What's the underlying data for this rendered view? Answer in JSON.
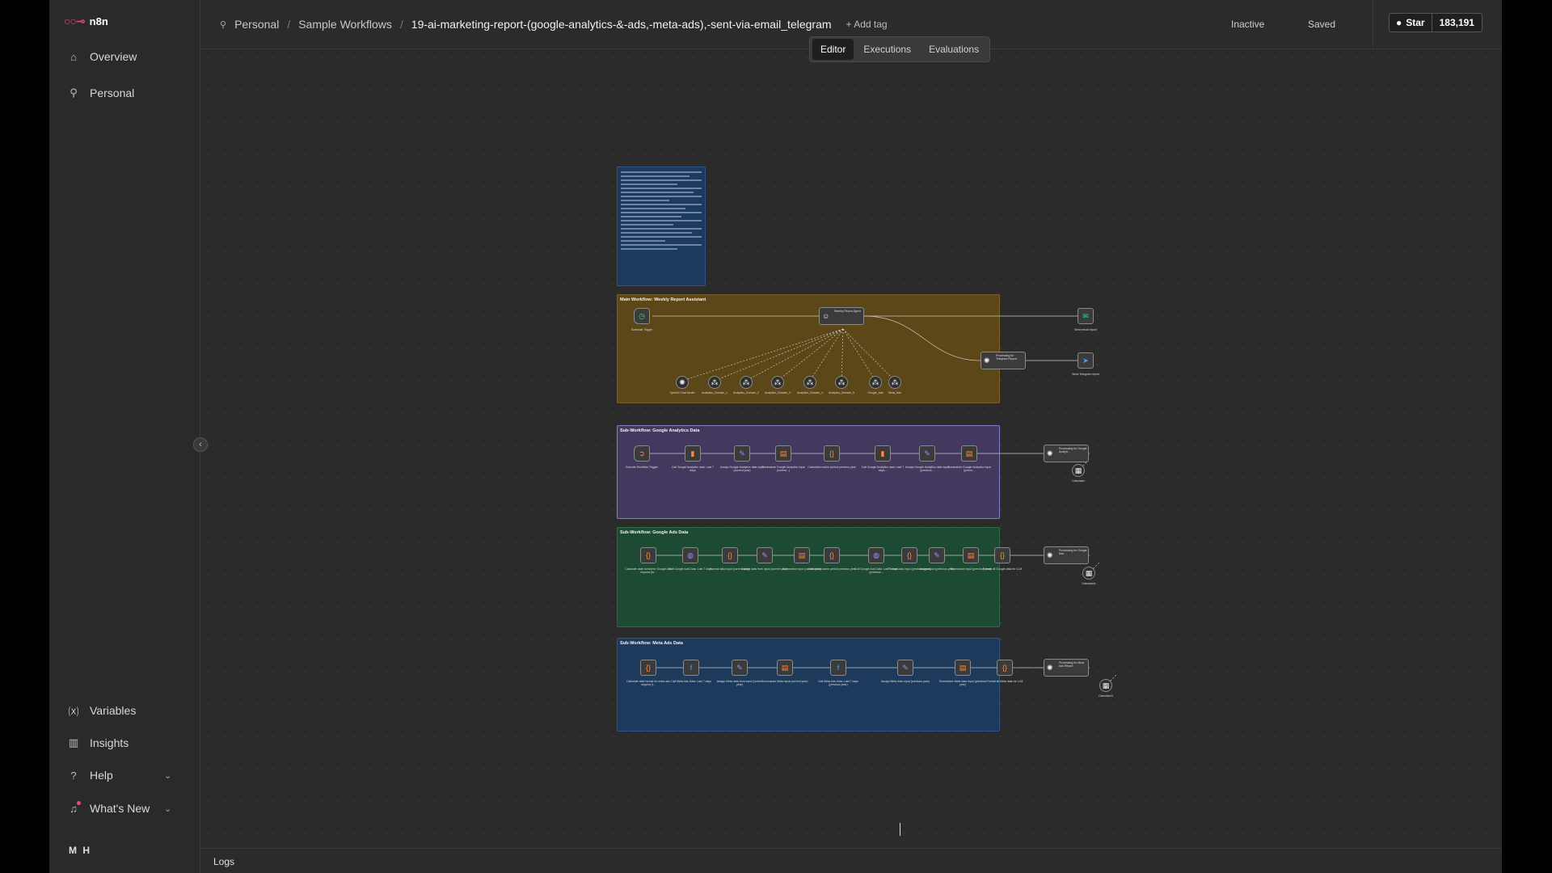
{
  "app": {
    "logo_text": "n8n",
    "user_initials": "M H"
  },
  "sidebar": {
    "items": [
      {
        "label": "Overview",
        "icon": "home-icon"
      },
      {
        "label": "Personal",
        "icon": "user-icon"
      }
    ],
    "bottom_items": [
      {
        "label": "Variables",
        "icon": "variables-icon"
      },
      {
        "label": "Insights",
        "icon": "chart-icon"
      },
      {
        "label": "Help",
        "icon": "help-icon"
      },
      {
        "label": "What's New",
        "icon": "bell-icon"
      }
    ]
  },
  "header": {
    "breadcrumb": [
      "Personal",
      "Sample Workflows"
    ],
    "workflow_name": "19-ai-marketing-report-(google-analytics-&-ads,-meta-ads),-sent-via-email_telegram",
    "add_tag": "+ Add tag",
    "status_active": "Inactive",
    "status_saved": "Saved",
    "github_star": "Star",
    "github_count": "183,191"
  },
  "tabs": [
    {
      "label": "Editor",
      "active": true
    },
    {
      "label": "Executions",
      "active": false
    },
    {
      "label": "Evaluations",
      "active": false
    }
  ],
  "canvas": {
    "notes": [
      {
        "title": "Main Workflow: Weekly Report Assistant",
        "color": "#5b4717"
      },
      {
        "title": "Sub-Workflow: Google Analytics Data",
        "color": "#43395f"
      },
      {
        "title": "Sub-Workflow: Google Ads Data",
        "color": "#1d4a32"
      },
      {
        "title": "Sub-Workflow: Meta Ads Data",
        "color": "#1d3a5c"
      }
    ],
    "main_nodes": [
      {
        "label": "Schedule Trigger"
      },
      {
        "label": "Weekly Report Agent"
      },
      {
        "label": "Send email report"
      },
      {
        "label": "Processing for Telegram Report"
      },
      {
        "label": "Send Telegram report"
      },
      {
        "label": "OpenAI Chat Model"
      },
      {
        "label": "Analytics_Domain_1"
      },
      {
        "label": "Analytics_Domain_2"
      },
      {
        "label": "Analytics_Domain_3"
      },
      {
        "label": "Analytics_Domain_4"
      },
      {
        "label": "Analytics_Domain_5"
      },
      {
        "label": "Google_Ads"
      },
      {
        "label": "Meta_Ads"
      }
    ],
    "ga_nodes": [
      {
        "label": "Execute Workflow Trigger"
      },
      {
        "label": "Call Google Analytics data: Last 7 days"
      },
      {
        "label": "Assign Google Analytics data input (current year)"
      },
      {
        "label": "Summarize Google Analytics input (current...)"
      },
      {
        "label": "Calculation same period previous year"
      },
      {
        "label": "Call Google Analytics data: Last 7 days..."
      },
      {
        "label": "Assign Google Analytics data input (previous..."
      },
      {
        "label": "Summarize Google Analytics input (previo..."
      },
      {
        "label": "Processing for Google Analyti..."
      },
      {
        "label": "Calculator"
      }
    ],
    "gads_nodes": [
      {
        "label": "Calculate date format for Google Ads request (la..."
      },
      {
        "label": "Call Google Ads Data: Last 7 days"
      },
      {
        "label": "Format data input (current year)"
      },
      {
        "label": "Assign data from input (current year)"
      },
      {
        "label": "Summarize input (current year)"
      },
      {
        "label": "Calculation same period previous year"
      },
      {
        "label": "Call Google Ads Data: Last 7 days (previous..."
      },
      {
        "label": "Format data input (previous year)"
      },
      {
        "label": "Assign input (previous year)"
      },
      {
        "label": "Summarize input (previous year)"
      },
      {
        "label": "Format all Google data for LLM"
      },
      {
        "label": "Processing for Google Ads"
      },
      {
        "label": "Calculator1"
      }
    ],
    "meta_nodes": [
      {
        "label": "Calculate date format for meta ads request (l..."
      },
      {
        "label": "Call Meta Ads Data: Last 7 days"
      },
      {
        "label": "Assign Meta data from input (current year)"
      },
      {
        "label": "Summarize Meta input (current year)"
      },
      {
        "label": "Call Meta Ads Data: Last 7 days (previous year)"
      },
      {
        "label": "Assign Meta data input (previous year)"
      },
      {
        "label": "Summarize Meta data input (previous year)"
      },
      {
        "label": "Format all Meta data for LLM"
      },
      {
        "label": "Processing for Meta Ads Report"
      },
      {
        "label": "Calculator3"
      }
    ]
  },
  "logs": {
    "label": "Logs"
  },
  "colors": {
    "accent": "#ea4b71",
    "background": "#2b2b2b"
  }
}
